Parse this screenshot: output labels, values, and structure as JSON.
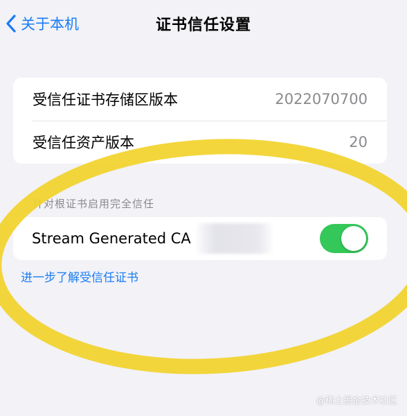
{
  "nav": {
    "back_label": "关于本机",
    "title": "证书信任设置"
  },
  "versions": {
    "rows": [
      {
        "label": "受信任证书存储区版本",
        "value": "2022070700"
      },
      {
        "label": "受信任资产版本",
        "value": "20"
      }
    ]
  },
  "root_trust": {
    "header": "针对根证书启用完全信任",
    "certificate_name": "Stream Generated CA",
    "enabled": true,
    "toggle_color": "#34c759"
  },
  "learn_more_label": "进一步了解受信任证书",
  "watermark": "@稀土掘金技术社区",
  "colors": {
    "accent": "#1a7cf4",
    "highlight": "#f2d32a",
    "background": "#f2f2f7"
  }
}
